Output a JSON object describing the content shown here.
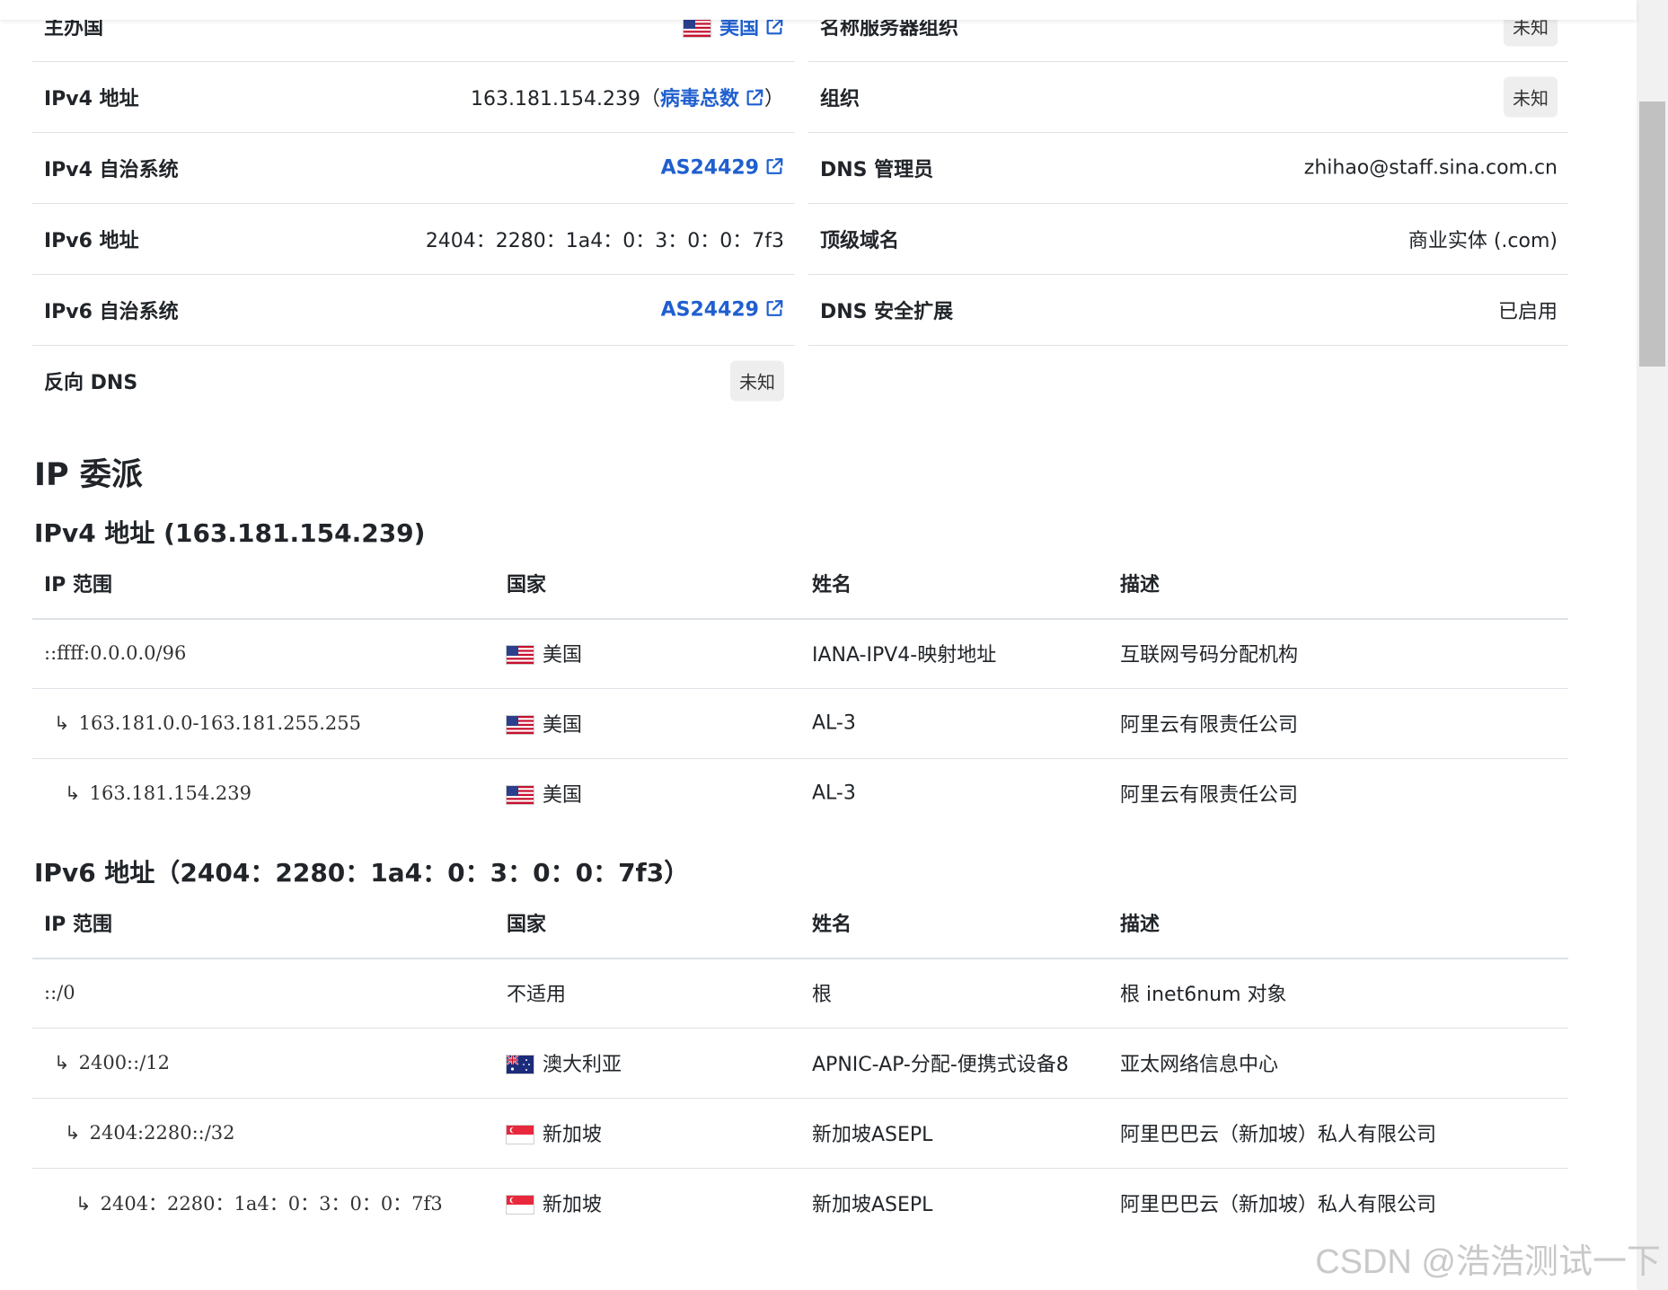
{
  "summary": {
    "left": [
      {
        "label": "主办国",
        "value": "美国",
        "flag": "us-flag-icon",
        "ext": "external-link-icon"
      },
      {
        "label": "IPv4 地址",
        "value": "163.181.154.239",
        "paren_open": "（",
        "link": "病毒总数",
        "paren_close": "）",
        "ext": "external-link-icon"
      },
      {
        "label": "IPv4 自治系统",
        "value": "AS24429",
        "ext": "external-link-icon"
      },
      {
        "label": "IPv6 地址",
        "value": "2404：2280：1a4：0：3：0：0：7f3"
      },
      {
        "label": "IPv6 自治系统",
        "value": "AS24429",
        "ext": "external-link-icon"
      },
      {
        "label": "反向 DNS",
        "value": "未知"
      }
    ],
    "right": [
      {
        "label": "名称服务器组织",
        "value": "未知"
      },
      {
        "label": "组织",
        "value": "未知"
      },
      {
        "label": "DNS 管理员",
        "value": "zhihao@staff.sina.com.cn"
      },
      {
        "label": "顶级域名",
        "value": "商业实体 (.com)"
      },
      {
        "label": "DNS 安全扩展",
        "value": "已启用"
      }
    ]
  },
  "delegation": {
    "title": "IP 委派",
    "columns": [
      "IP 范围",
      "国家",
      "姓名",
      "描述"
    ],
    "ipv4": {
      "title": "IPv4 地址 (163.181.154.239)",
      "rows": [
        {
          "range": "::ffff:0.0.0.0/96",
          "country": "美国",
          "flag": "us-flag-icon",
          "name": "IANA-IPV4-映射地址",
          "desc": "互联网号码分配机构"
        },
        {
          "range": "163.181.0.0-163.181.255.255",
          "country": "美国",
          "flag": "us-flag-icon",
          "name": "AL-3",
          "desc": "阿里云有限责任公司"
        },
        {
          "range": "163.181.154.239",
          "country": "美国",
          "flag": "us-flag-icon",
          "name": "AL-3",
          "desc": "阿里云有限责任公司"
        }
      ]
    },
    "ipv6": {
      "title": "IPv6 地址（2404：2280：1a4：0：3：0：0：7f3）",
      "rows": [
        {
          "range": "::/0",
          "country": "不适用",
          "name": "根",
          "desc": "根 inet6num 对象"
        },
        {
          "range": "2400::/12",
          "country": "澳大利亚",
          "flag": "au-flag-icon",
          "name": "APNIC-AP-分配-便携式设备8",
          "desc": "亚太网络信息中心"
        },
        {
          "range": "2404:2280::/32",
          "country": "新加坡",
          "flag": "sg-flag-icon",
          "name": "新加坡ASEPL",
          "desc": "阿里巴巴云（新加坡）私人有限公司"
        },
        {
          "range": "2404：2280：1a4：0：3：0：0：7f3",
          "country": "新加坡",
          "flag": "sg-flag-icon",
          "name": "新加坡ASEPL",
          "desc": "阿里巴巴云（新加坡）私人有限公司"
        }
      ]
    }
  },
  "watermark": "CSDN @浩浩测试一下"
}
